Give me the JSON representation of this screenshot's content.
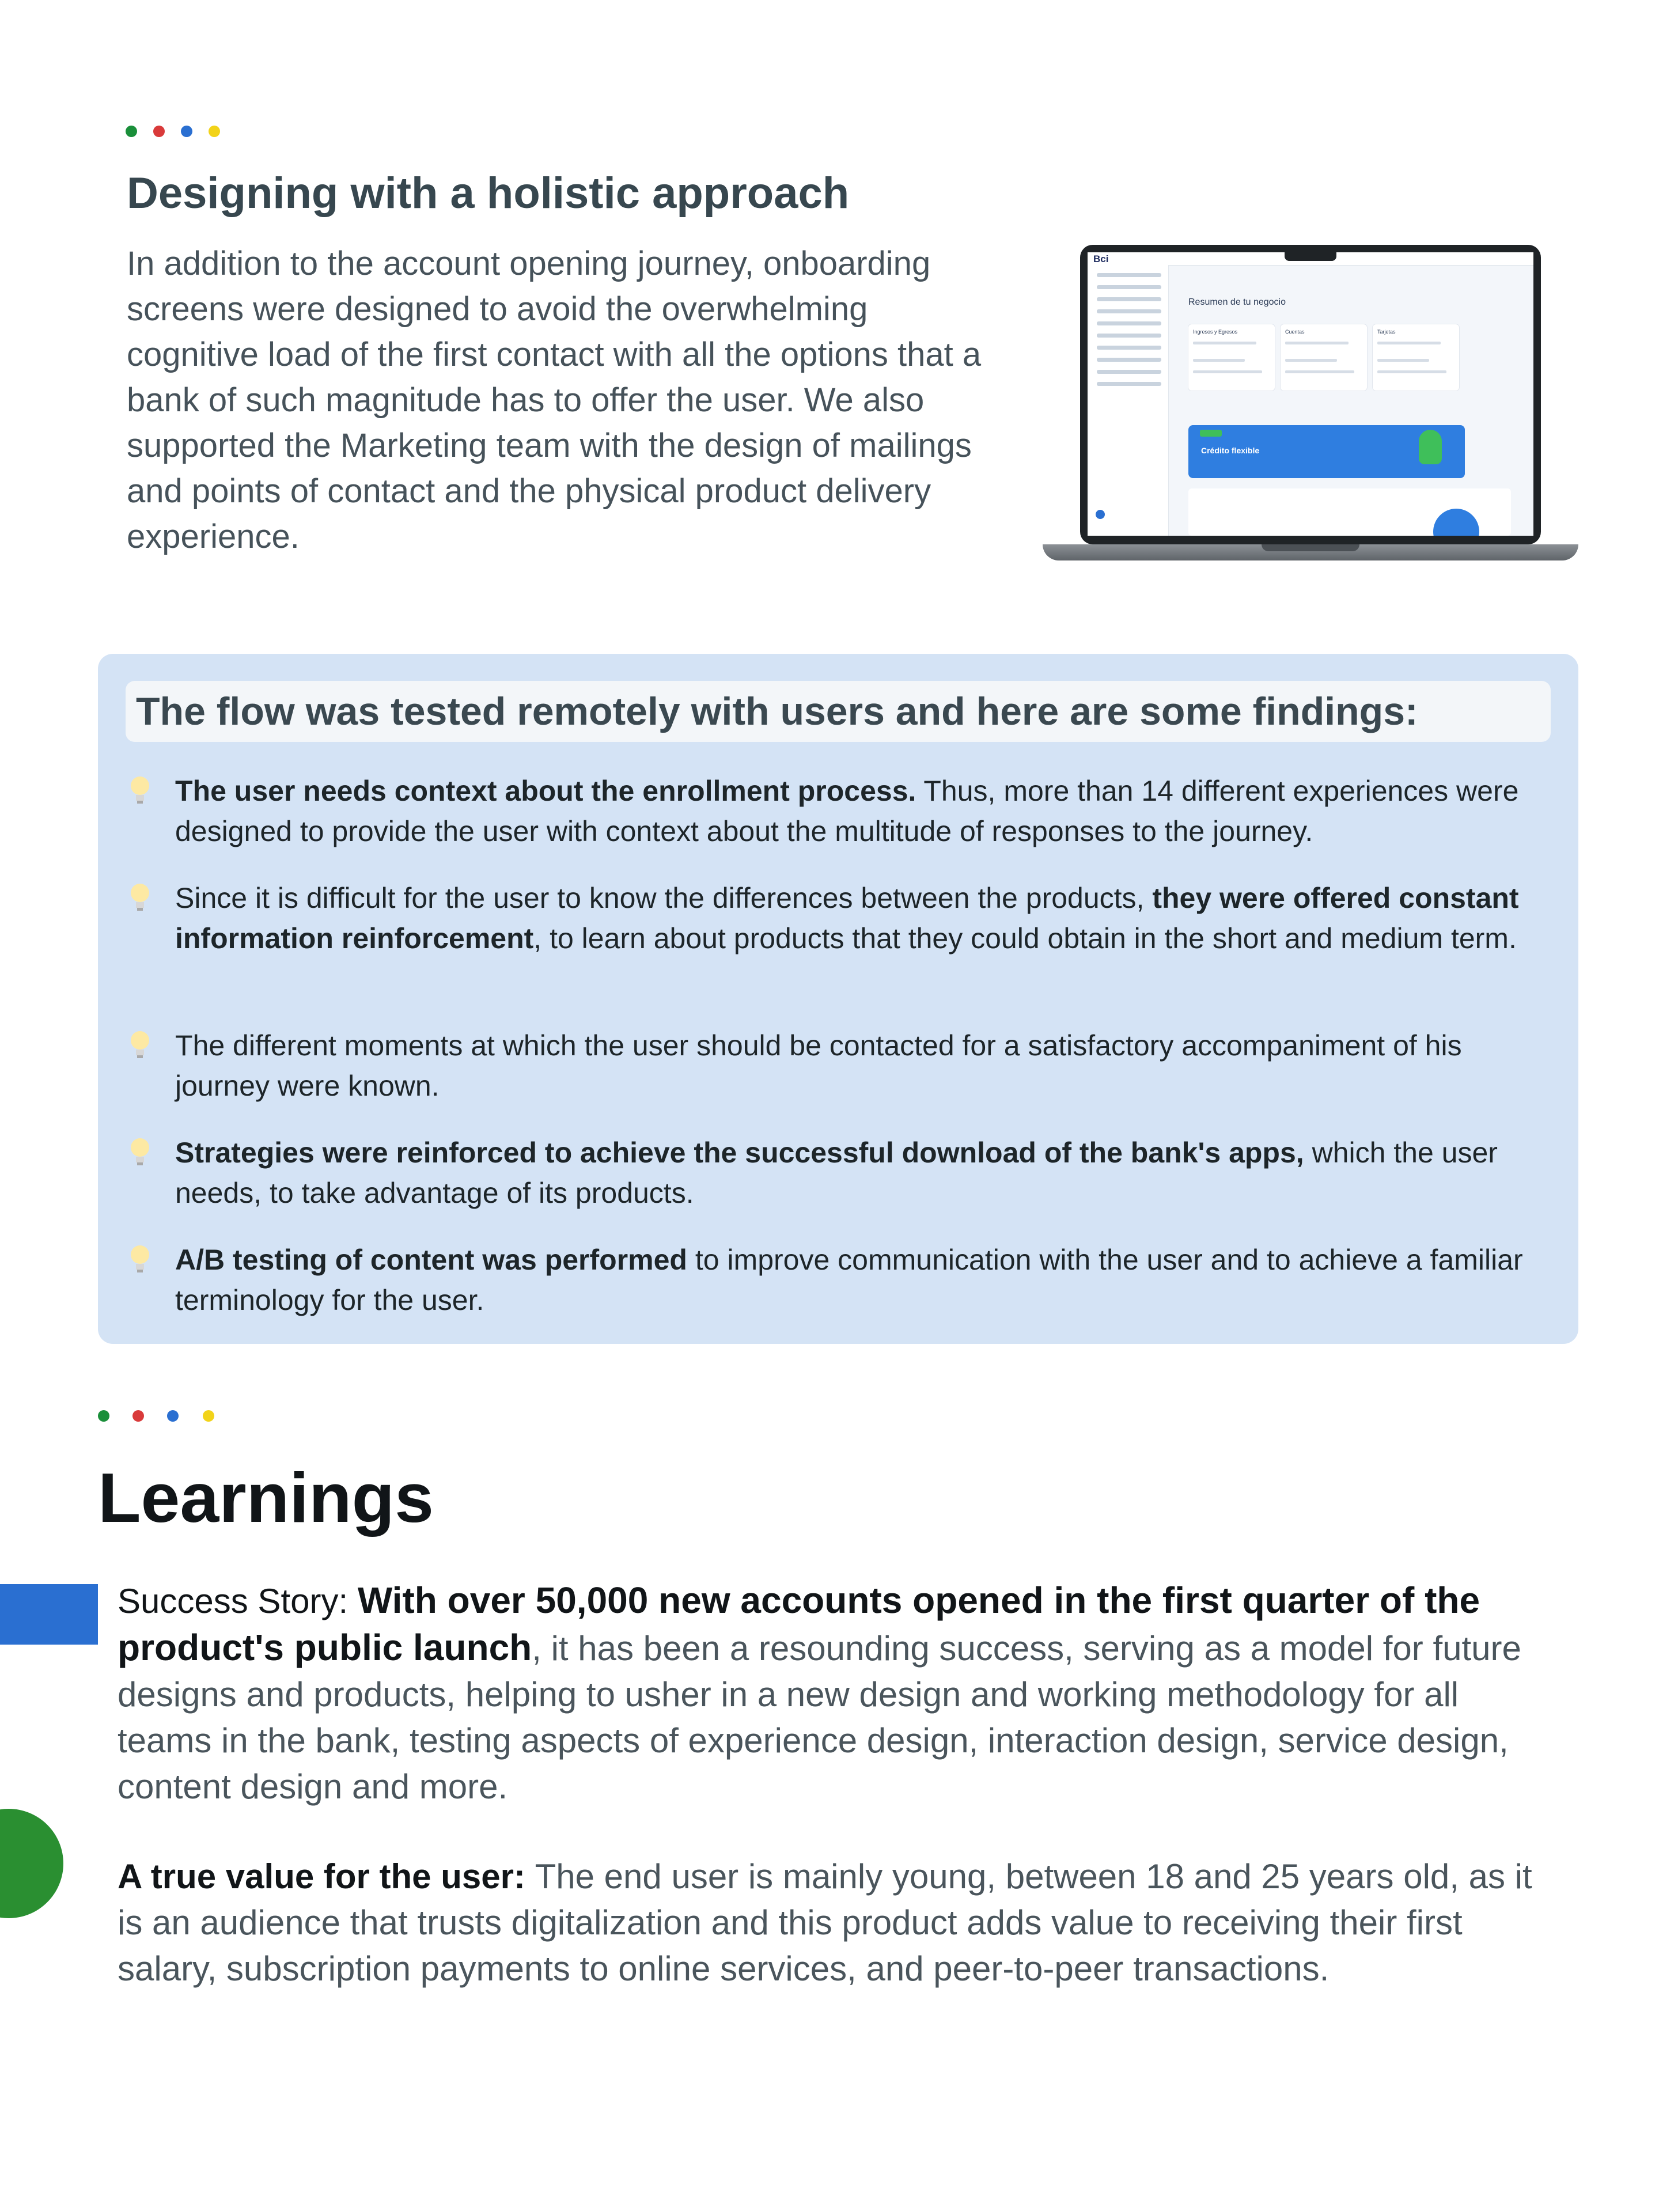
{
  "colors": {
    "green": "#1a8f3a",
    "red": "#d93a3a",
    "blue": "#2a6fd1",
    "yellow": "#f2d319",
    "panel": "#d4e3f5"
  },
  "section1": {
    "title": "Designing with a holistic approach",
    "body": "In addition to the account opening journey, onboarding screens were designed to avoid the overwhelming cognitive load of the first contact with all the options that a bank of such magnitude has to offer the user. We also supported the Marketing team with the design of mailings and points of contact and the physical product delivery experience."
  },
  "laptop_screen": {
    "logo": "Bci",
    "heading": "Resumen de tu negocio",
    "cards": [
      "Ingresos y Egresos",
      "Cuentas",
      "Tarjetas"
    ],
    "banner_title": "Crédito flexible"
  },
  "findings": {
    "title": "The flow was tested remotely with users and here are some findings:",
    "items": [
      {
        "bold": "The user needs context about the enrollment process.",
        "text": " Thus, more than 14 different experiences were designed to provide the user with context about the multitude of responses to the journey."
      },
      {
        "pre": "Since it is difficult for the user to know the differences between the products, ",
        "bold": "they were offered constant information reinforcement",
        "text": ", to learn about products that they could obtain in the short and medium term."
      },
      {
        "text": "The different moments at which the user should be contacted for a satisfactory accompaniment of his journey were known."
      },
      {
        "bold": "Strategies were reinforced to achieve the successful download of the bank's apps,",
        "text": " which the user needs, to take advantage of its products."
      },
      {
        "bold": "A/B testing of content was performed",
        "text": " to improve communication with the user and to achieve a familiar terminology for the user."
      }
    ]
  },
  "learnings": {
    "title": "Learnings",
    "success": {
      "label": "Success Story: ",
      "bold": "With over 50,000 new accounts opened in the first quarter of the product's public launch",
      "text": ", it has been a resounding success, serving as a model for future designs and products, helping to usher in a new design and working methodology for all teams in the bank, testing aspects of experience design, interaction design, service design, content design and more."
    },
    "value": {
      "label": "A true value for the user: ",
      "text": "The end user is mainly young, between 18 and 25 years old, as it is an audience that trusts digitalization and this product adds value to receiving their first salary, subscription payments to online services, and peer-to-peer transactions."
    }
  }
}
